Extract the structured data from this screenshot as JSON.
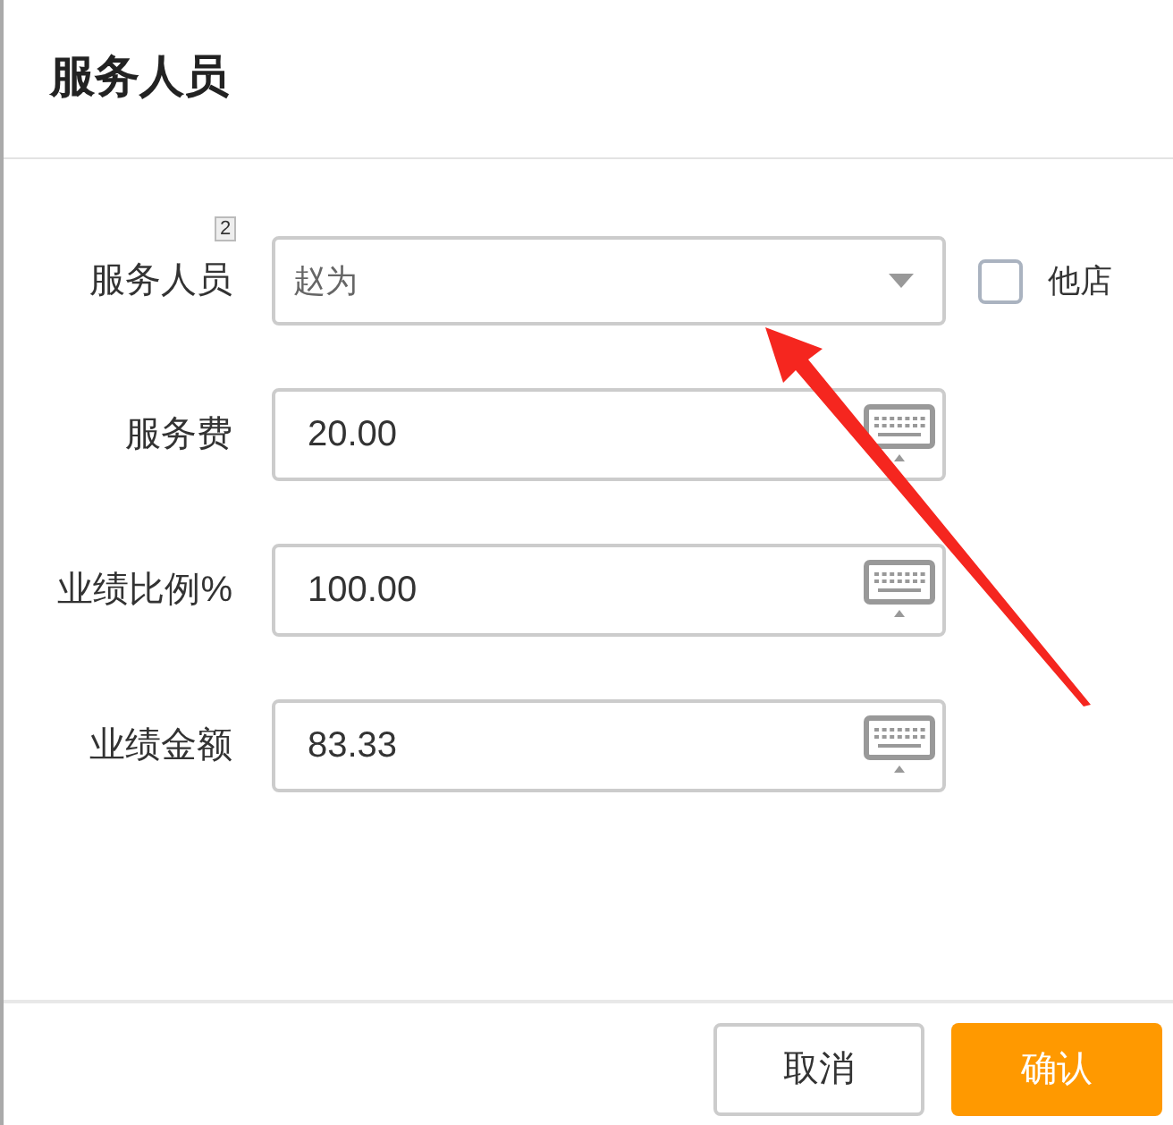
{
  "dialog": {
    "title": "服务人员"
  },
  "badge": "2",
  "rows": [
    {
      "kind": "select",
      "label": "服务人员",
      "value": "赵为",
      "checkbox": {
        "label": "他店",
        "checked": false
      }
    },
    {
      "kind": "input",
      "label": "服务费",
      "value": "20.00"
    },
    {
      "kind": "input",
      "label": "业绩比例%",
      "value": "100.00"
    },
    {
      "kind": "input",
      "label": "业绩金额",
      "value": "83.33"
    }
  ],
  "buttons": [
    {
      "kind": "secondary",
      "label": "取消"
    },
    {
      "kind": "primary",
      "label": "确认"
    }
  ]
}
